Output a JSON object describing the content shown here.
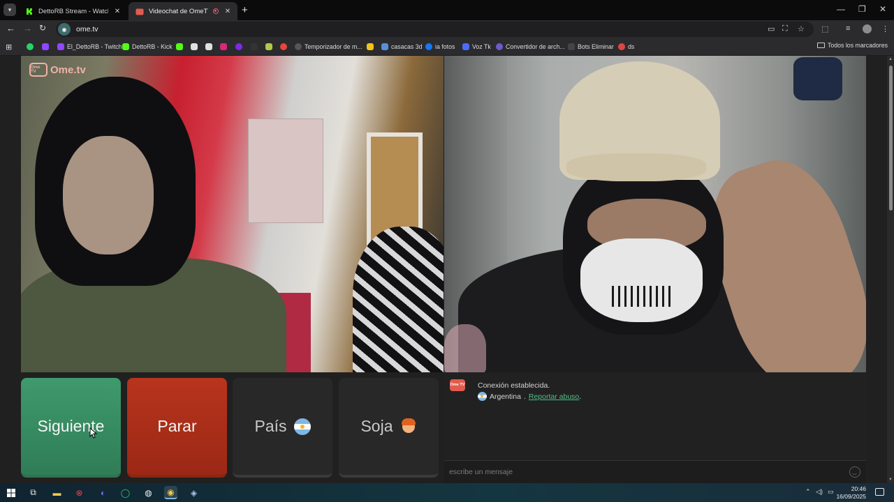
{
  "browser": {
    "tabs": [
      {
        "title": "DettoRB Stream - Watch Live o",
        "favicon": "kick-icon",
        "active": false
      },
      {
        "title": "Videochat de OmeTV: una",
        "favicon": "ometv-icon",
        "active": true,
        "recording": true
      }
    ],
    "address": "ome.tv",
    "bookmarks": [
      {
        "label": "",
        "icon": "whatsapp-icon",
        "color": "#25d366"
      },
      {
        "label": "",
        "icon": "twitch-icon",
        "color": "#9146ff"
      },
      {
        "label": "El_DettoRB - Twitch",
        "icon": "twitch-icon",
        "color": "#9146ff"
      },
      {
        "label": "DettoRB - Kick",
        "icon": "kick-icon",
        "color": "#53fc18"
      },
      {
        "label": "",
        "icon": "kick-icon",
        "color": "#53fc18"
      },
      {
        "label": "",
        "icon": "tiktok-icon",
        "color": "#e0e0e0"
      },
      {
        "label": "",
        "icon": "x-icon",
        "color": "#e0e0e0"
      },
      {
        "label": "",
        "icon": "instagram-icon",
        "color": "#d62976"
      },
      {
        "label": "",
        "icon": "canva-icon",
        "color": "#7d2ae8"
      },
      {
        "label": "",
        "icon": "fire-icon",
        "color": "#333333"
      },
      {
        "label": "",
        "icon": "puzzle-icon",
        "color": "#b0c84a"
      },
      {
        "label": "",
        "icon": "dots-icon",
        "color": "#e8453c"
      },
      {
        "label": "Temporizador de m...",
        "icon": "timer-icon",
        "color": "#222222"
      },
      {
        "label": "",
        "icon": "folder-yellow-icon",
        "color": "#f0c419"
      },
      {
        "label": "casacas 3d",
        "icon": "image-icon",
        "color": "#5a8fd8"
      },
      {
        "label": "ia fotos",
        "icon": "meta-icon",
        "color": "#1877f2"
      },
      {
        "label": "Voz Tk",
        "icon": "voice-icon",
        "color": "#4a6cf7"
      },
      {
        "label": "Convertidor de arch...",
        "icon": "convert-icon",
        "color": "#6e5bd0"
      },
      {
        "label": "Bots Eliminar",
        "icon": "bot-icon",
        "color": "#333333"
      },
      {
        "label": "ds",
        "icon": "discord-icon",
        "color": "#e04545"
      }
    ],
    "all_bookmarks_label": "Todos los marcadores"
  },
  "app": {
    "logo_text": "Ome.tv",
    "logo_badge": "Ome TV"
  },
  "controls": {
    "next_label": "Siguiente",
    "stop_label": "Parar",
    "country_label": "País",
    "gender_label": "Soja"
  },
  "chat": {
    "badge": "Ome TV",
    "status": "Conexión establecida.",
    "country": "Argentina",
    "separator": ".",
    "report_link": "Reportar abuso",
    "report_suffix": ".",
    "input_placeholder": "escribe un mensaje"
  },
  "taskbar": {
    "time": "20:46",
    "date": "16/09/2025"
  },
  "colors": {
    "next": "#3a9166",
    "stop": "#ae2f19",
    "link": "#4fbf86"
  }
}
